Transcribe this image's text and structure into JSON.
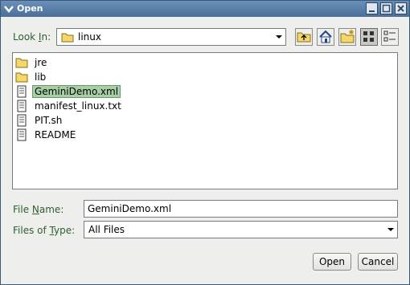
{
  "window": {
    "title": "Open"
  },
  "toolbar": {
    "look_in_label_pre": "Look ",
    "look_in_label_key": "I",
    "look_in_label_post": "n:",
    "look_in_value": "linux"
  },
  "files": [
    {
      "name": "jre",
      "type": "folder"
    },
    {
      "name": "lib",
      "type": "folder"
    },
    {
      "name": "GeminiDemo.xml",
      "type": "file",
      "selected": true
    },
    {
      "name": "manifest_linux.txt",
      "type": "file"
    },
    {
      "name": "PIT.sh",
      "type": "file"
    },
    {
      "name": "README",
      "type": "file"
    }
  ],
  "filename": {
    "label_pre": "File ",
    "label_key": "N",
    "label_post": "ame:",
    "value": "GeminiDemo.xml"
  },
  "filetype": {
    "label_pre": "Files of ",
    "label_key": "T",
    "label_post": "ype:",
    "value": "All Files"
  },
  "buttons": {
    "open": "Open",
    "cancel": "Cancel"
  },
  "colors": {
    "titlebar": "#4a6f9a",
    "label_green": "#2e5f2e",
    "selection": "#a6cfa6"
  }
}
